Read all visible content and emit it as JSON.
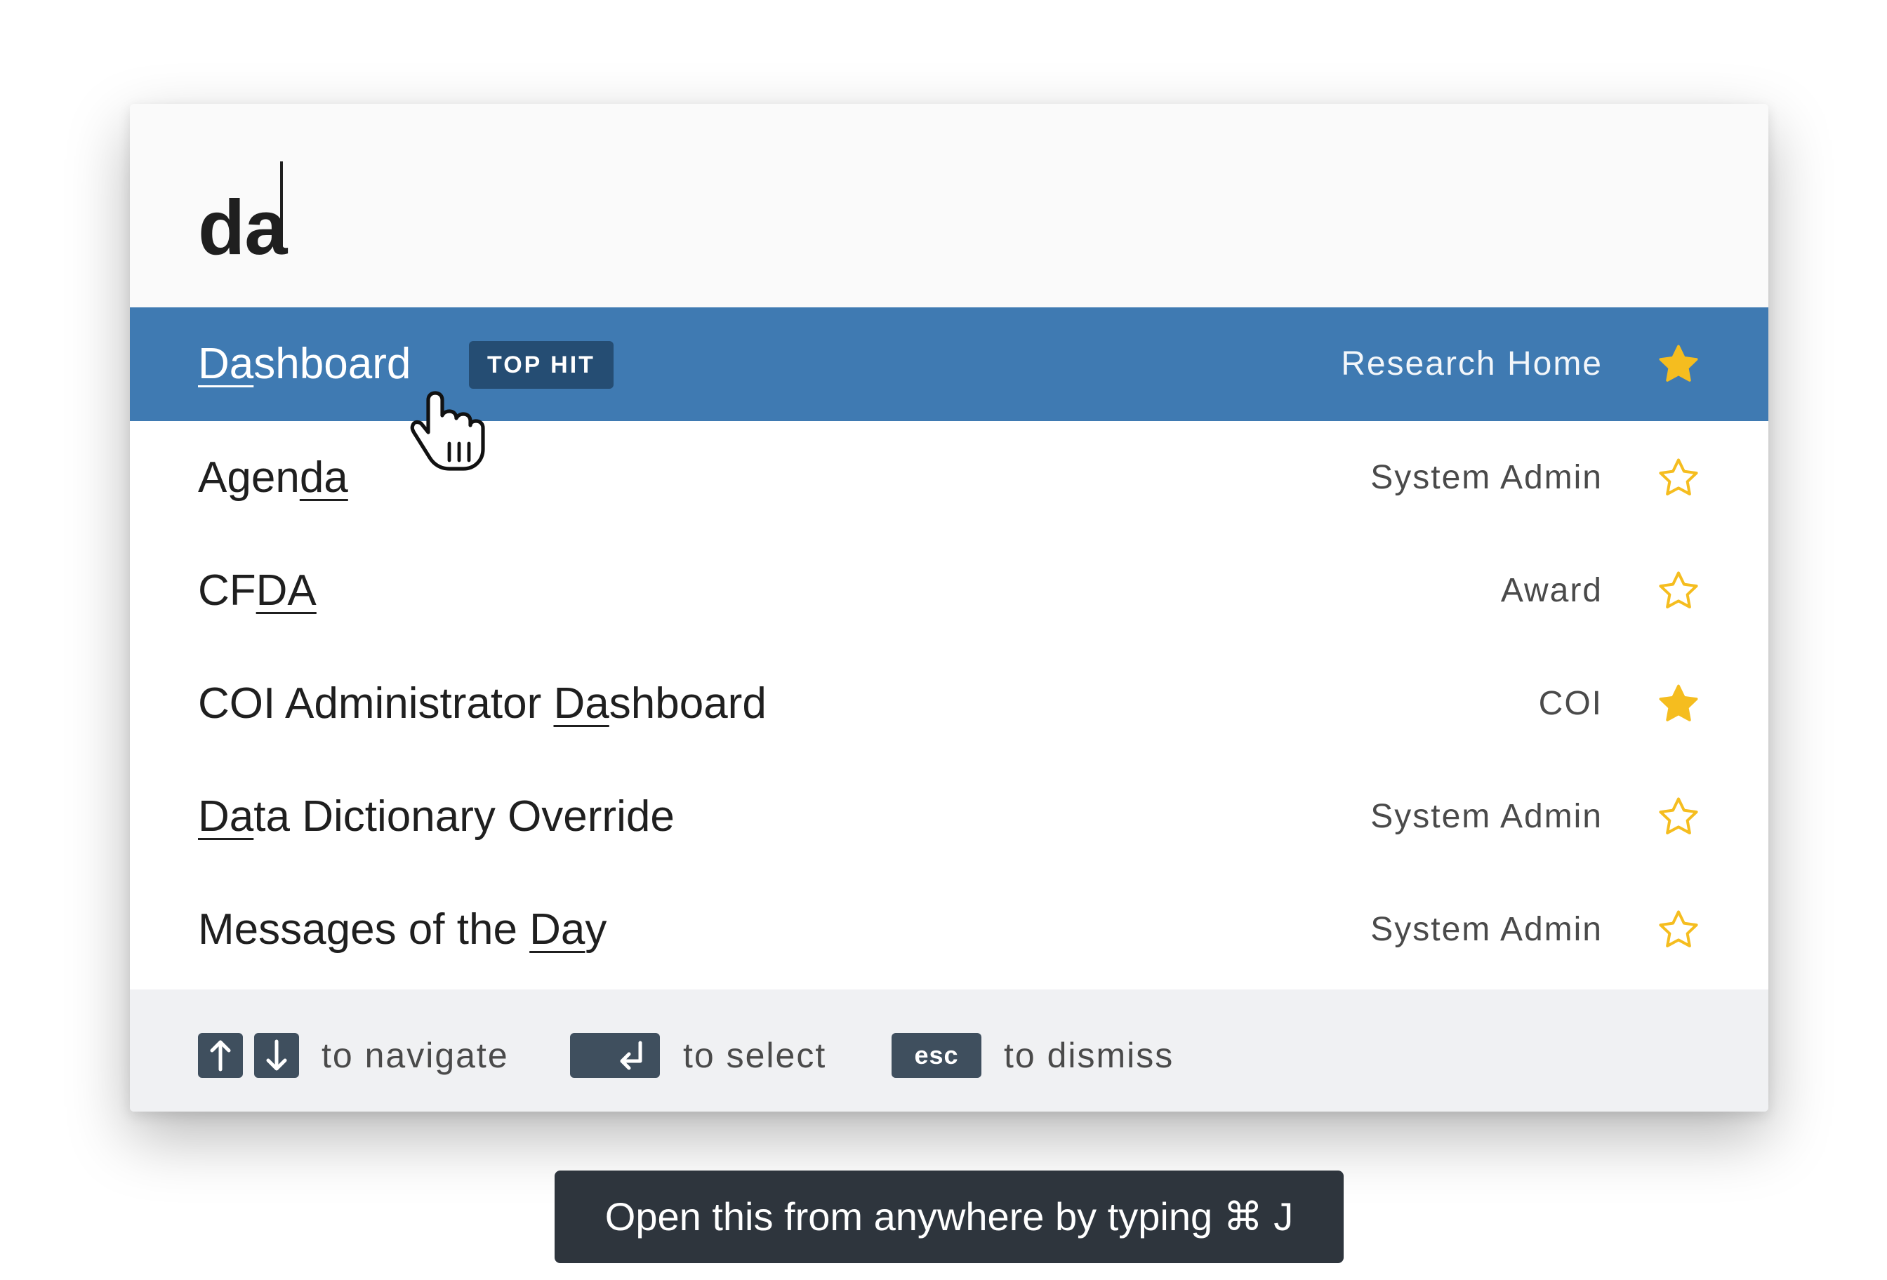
{
  "search": {
    "query": "da"
  },
  "results": [
    {
      "label_pre": "",
      "label_match": "Da",
      "label_post": "shboard",
      "badge": "TOP HIT",
      "category": "Research Home",
      "starred": true,
      "selected": true
    },
    {
      "label_pre": "Agen",
      "label_match": "da",
      "label_post": "",
      "category": "System Admin",
      "starred": false
    },
    {
      "label_pre": "CF",
      "label_match": "DA",
      "label_post": "",
      "category": "Award",
      "starred": false
    },
    {
      "label_pre": "COI Administrator ",
      "label_match": "Da",
      "label_post": "shboard",
      "category": "COI",
      "starred": true
    },
    {
      "label_pre": "",
      "label_match": "Da",
      "label_post": "ta Dictionary Override",
      "category": "System Admin",
      "starred": false
    },
    {
      "label_pre": "Messages of the ",
      "label_match": "Da",
      "label_post": "y",
      "category": "System Admin",
      "starred": false
    }
  ],
  "footer": {
    "navigate_hint": "to navigate",
    "select_hint": "to select",
    "dismiss_hint": "to dismiss",
    "esc_key": "esc",
    "icons": {
      "up": "arrow-up-icon",
      "down": "arrow-down-icon",
      "enter": "enter-icon"
    }
  },
  "tooltip": {
    "text": "Open this from anywhere by typing ⌘ J"
  },
  "colors": {
    "selected_row": "#3f7ab2",
    "badge": "#254d73",
    "star": "#f5bd1f",
    "key": "#3f4f5e",
    "tooltip": "#2e353d"
  },
  "cursor": {
    "icon": "hand-pointer-icon"
  }
}
